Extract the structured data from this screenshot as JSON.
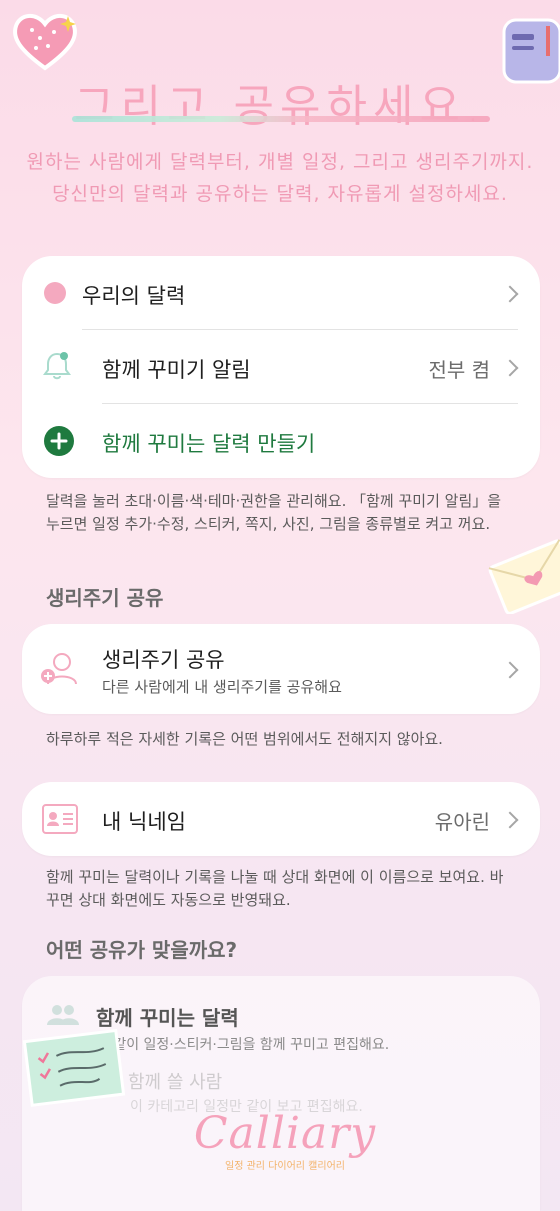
{
  "hero": {
    "title": "그리고 공유하세요.",
    "subtitle_line1": "원하는 사람에게 달력부터, 개별 일정, 그리고 생리주기까지.",
    "subtitle_line2": "당신만의 달력과 공유하는 달력, 자유롭게 설정하세요."
  },
  "calendars_card": {
    "our_calendar": "우리의 달력",
    "notify_label": "함께 꾸미기 알림",
    "notify_value": "전부 켬",
    "create_label": "함께 꾸미는 달력 만들기"
  },
  "calendars_note": "달력을 눌러 초대·이름·색·테마·권한을 관리해요. 「함께 꾸미기 알림」을 누르면 일정 추가·수정, 스티커, 쪽지, 사진, 그림을 종류별로 켜고 꺼요.",
  "cycle_section": {
    "title": "생리주기 공유",
    "item_title": "생리주기 공유",
    "item_sub": "다른 사람에게 내 생리주기를 공유해요",
    "note": "하루하루 적은 자세한 기록은 어떤 범위에서도 전해지지 않아요."
  },
  "nickname": {
    "label": "내 닉네임",
    "value": "유아린",
    "note": "함께 꾸미는 달력이나 기록을 나눌 때 상대 화면에 이 이름으로 보여요. 바꾸면 상대 화면에도 자동으로 반영돼요."
  },
  "which_share": {
    "title": "어떤 공유가 맞을까요?",
    "item1_title": "함께 꾸미는 달력",
    "item1_sub": "다 같이 일정·스티커·그림을 함께 꾸미고 편집해요.",
    "item2_title": "함께 쓸 사람",
    "item2_sub": "이 카테고리 일정만 같이 보고 편집해요."
  },
  "brand": {
    "logo": "Calliary",
    "tagline": "일정 관리 다이어리 캘리어리"
  },
  "colors": {
    "accent_pink": "#f4a9bf",
    "accent_green": "#1f7a3f",
    "title_pink": "#f7a6bd"
  },
  "icons": {
    "heart_sticker": "heart-sticker",
    "mailbox_sticker": "mailbox-sticker",
    "bell": "bell-icon",
    "plus": "plus-circle-icon",
    "envelope": "envelope-sticker",
    "people": "people-icon",
    "id_card": "id-card-icon",
    "note_sticker": "checklist-note-sticker"
  }
}
